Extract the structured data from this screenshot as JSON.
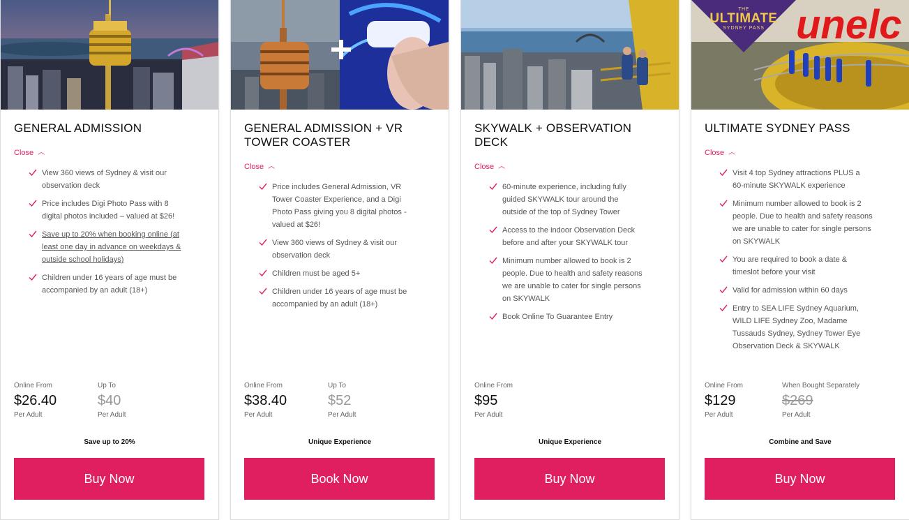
{
  "accent_color": "#df1f5f",
  "cards": [
    {
      "title": "GENERAL ADMISSION",
      "toggle_label": "Close",
      "features": [
        "View 360 views of Sydney & visit our observation deck",
        "Price includes Digi Photo Pass with 8 digital photos included – valued at $26!",
        "Save up to 20% when booking online (at least one day in advance on weekdays & outside school holidays)",
        "Children under 16 years of age must be accompanied by an adult (18+)"
      ],
      "price_primary": {
        "label": "Online From",
        "amount": "$26.40",
        "unit": "Per Adult"
      },
      "price_secondary": {
        "label": "Up To",
        "amount": "$40",
        "unit": "Per Adult"
      },
      "tagline": "Save up to 20%",
      "button": "Buy Now"
    },
    {
      "title": "GENERAL ADMISSION + VR TOWER COASTER",
      "toggle_label": "Close",
      "features": [
        "Price includes General Admission, VR Tower Coaster Experience, and a Digi Photo Pass giving you 8 digital photos - valued at $26!",
        "View 360 views of Sydney & visit our observation deck",
        "Children must be aged 5+",
        "Children under 16 years of age must be accompanied by an adult (18+)"
      ],
      "price_primary": {
        "label": "Online From",
        "amount": "$38.40",
        "unit": "Per Adult"
      },
      "price_secondary": {
        "label": "Up To",
        "amount": "$52",
        "unit": "Per Adult"
      },
      "tagline": "Unique Experience",
      "button": "Book Now"
    },
    {
      "title": "SKYWALK + OBSERVATION DECK",
      "toggle_label": "Close",
      "features": [
        "60-minute experience, including fully guided SKYWALK tour around the outside of the top of Sydney Tower",
        "Access to the indoor Observation Deck before and after your SKYWALK tour",
        "Minimum number allowed to book is 2 people. Due to health and safety reasons we are unable to cater for single persons on SKYWALK",
        "Book Online To Guarantee Entry"
      ],
      "price_primary": {
        "label": "Online From",
        "amount": "$95",
        "unit": "Per Adult"
      },
      "tagline": "Unique Experience",
      "button": "Buy Now"
    },
    {
      "title": "ULTIMATE SYDNEY PASS",
      "toggle_label": "Close",
      "features": [
        "Visit 4 top Sydney attractions PLUS a 60-minute SKYWALK experience",
        "Minimum number allowed to book is 2 people. Due to health and safety reasons we are unable to cater for single persons on SKYWALK",
        "You are required to book a date & timeslot before your visit",
        "Valid for admission within 60 days",
        "Entry to SEA LIFE Sydney Aquarium, WILD LIFE Sydney Zoo, Madame Tussauds Sydney, Sydney Tower Eye Observation Deck & SKYWALK"
      ],
      "price_primary": {
        "label": "Online From",
        "amount": "$129",
        "unit": "Per Adult"
      },
      "price_secondary": {
        "label": "When Bought Separately",
        "amount": "$269",
        "unit": "Per Adult"
      },
      "badge": {
        "line1": "THE",
        "line2": "ULTIMATE",
        "line3": "SYDNEY PASS"
      },
      "tagline": "Combine and Save",
      "button": "Buy Now"
    }
  ]
}
